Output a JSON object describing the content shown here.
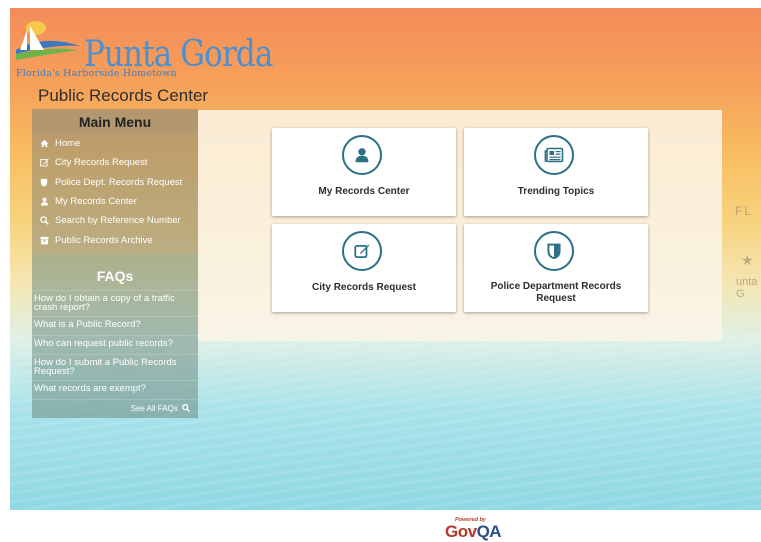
{
  "header": {
    "logo_title": "Punta Gorda",
    "logo_tagline": "Florida's Harborside Hometown",
    "center_title": "Public Records Center"
  },
  "sidebar": {
    "main_menu_title": "Main Menu",
    "items": [
      {
        "label": "Home",
        "icon": "home-icon"
      },
      {
        "label": "City Records Request",
        "icon": "edit-icon"
      },
      {
        "label": "Police Dept. Records Request",
        "icon": "shield-icon"
      },
      {
        "label": "My Records Center",
        "icon": "user-icon"
      },
      {
        "label": "Search by Reference Number",
        "icon": "search-icon"
      },
      {
        "label": "Public Records Archive",
        "icon": "archive-icon"
      }
    ],
    "faq_title": "FAQs",
    "faqs": [
      "How do I obtain a copy of a traffic crash report?",
      "What is a Public Record?",
      "Who can request public records?",
      "How do I submit a Public Records Request?",
      "What records are exempt?"
    ],
    "see_all": "See All FAQs"
  },
  "cards": [
    {
      "label": "My Records Center",
      "icon": "user-icon"
    },
    {
      "label": "Trending Topics",
      "icon": "newspaper-icon"
    },
    {
      "label": "City Records Request",
      "icon": "edit-icon"
    },
    {
      "label": "Police Department Records Request",
      "icon": "shield-icon"
    }
  ],
  "map_labels": {
    "fl": "FL",
    "punta": "unta G"
  },
  "footer": {
    "powered_by": "Powered by",
    "brand_gov": "Gov",
    "brand_qa": "QA"
  },
  "colors": {
    "accent": "#2c6f87",
    "logo_blue": "#4a8fd0",
    "govqa_red": "#b23a2a"
  }
}
